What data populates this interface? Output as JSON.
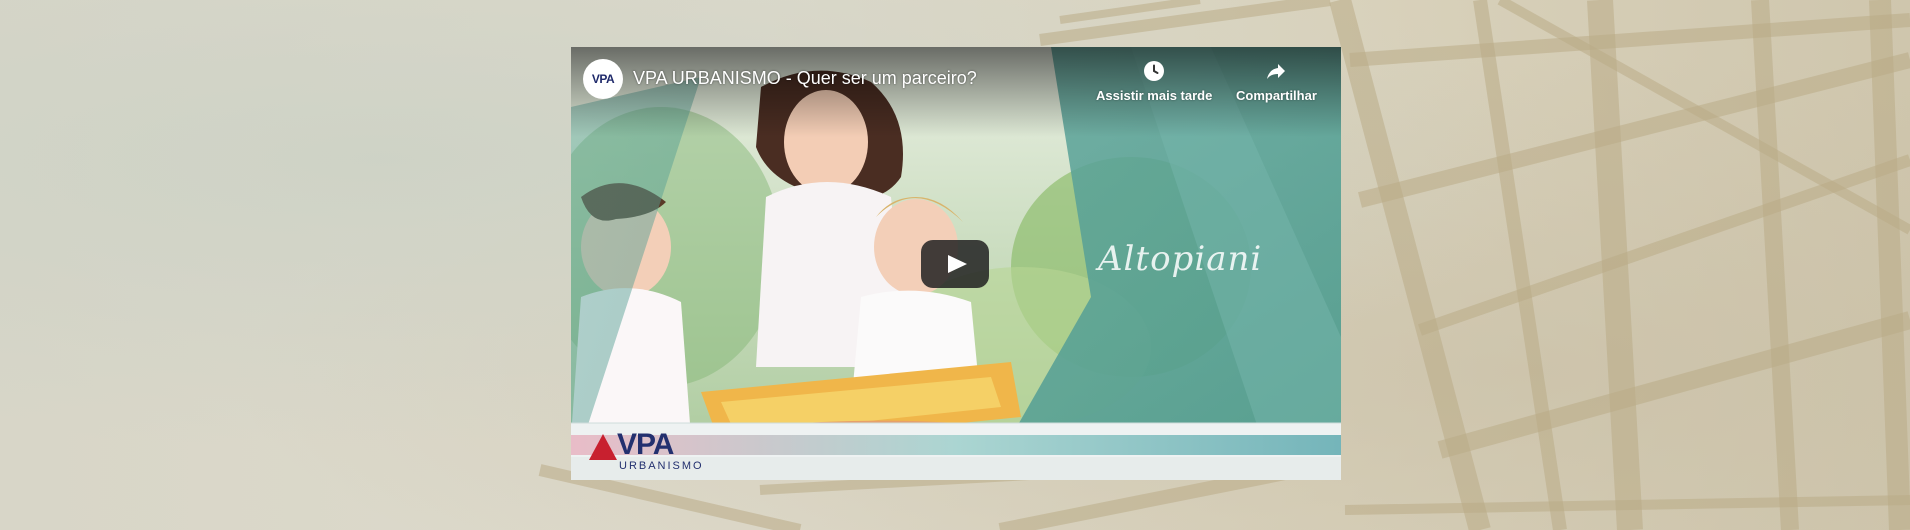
{
  "video": {
    "title": "VPA URBANISMO - Quer ser um parceiro?",
    "channel_avatar_text": "VPA",
    "watch_later_label": "Assistir mais tarde",
    "share_label": "Compartilhar",
    "play_icon": "play-icon",
    "watermark": "Altopiani",
    "brand_logo": {
      "main": "VPA",
      "sub": "URBANISMO"
    }
  },
  "colors": {
    "page_background": "#ddd8c6",
    "overlay_teal": "#6faea4",
    "play_button": "#212121",
    "brand_navy": "#23306f",
    "brand_red": "#c8202f"
  }
}
